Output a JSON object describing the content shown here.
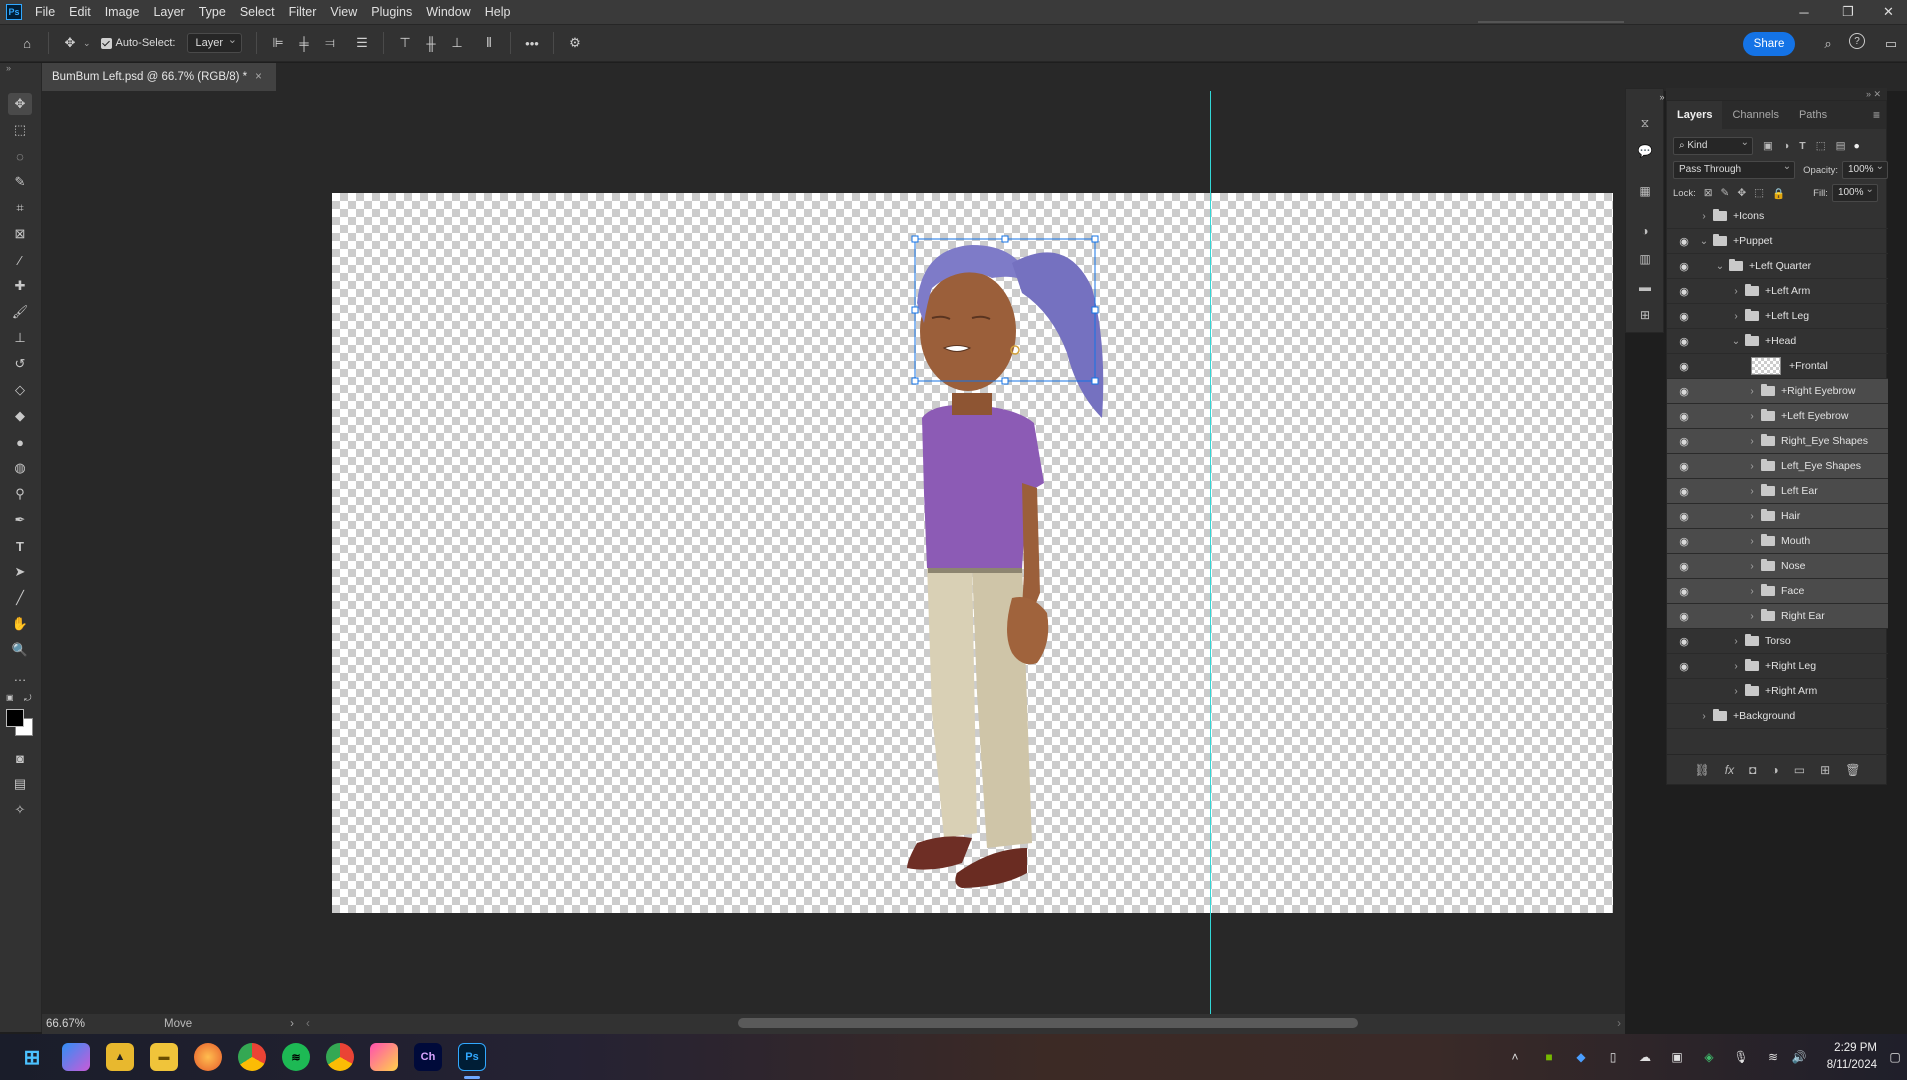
{
  "menubar": {
    "app_logo": "Ps",
    "items": [
      "File",
      "Edit",
      "Image",
      "Layer",
      "Type",
      "Select",
      "Filter",
      "View",
      "Plugins",
      "Window",
      "Help"
    ]
  },
  "options_bar": {
    "auto_select_label": "Auto-Select:",
    "auto_select_target": "Layer",
    "share_label": "Share"
  },
  "document": {
    "tab_title": "BumBum Left.psd @ 66.7% (RGB/8) *",
    "close_glyph": "×"
  },
  "status": {
    "zoom": "66.67%",
    "tool_info": "Move"
  },
  "layers_panel": {
    "tabs": [
      "Layers",
      "Channels",
      "Paths"
    ],
    "filter_kind": "Kind",
    "blend_mode": "Pass Through",
    "opacity_label": "Opacity:",
    "opacity_value": "100%",
    "lock_label": "Lock:",
    "fill_label": "Fill:",
    "fill_value": "100%",
    "layers": [
      {
        "name": "+Icons",
        "visible": false,
        "depth": 0,
        "expanded": false,
        "type": "group",
        "selected": false
      },
      {
        "name": "+Puppet",
        "visible": true,
        "depth": 0,
        "expanded": true,
        "type": "group",
        "selected": false
      },
      {
        "name": "+Left Quarter",
        "visible": true,
        "depth": 1,
        "expanded": true,
        "type": "group",
        "selected": false
      },
      {
        "name": "+Left Arm",
        "visible": true,
        "depth": 2,
        "expanded": false,
        "type": "group",
        "selected": false
      },
      {
        "name": "+Left Leg",
        "visible": true,
        "depth": 2,
        "expanded": false,
        "type": "group",
        "selected": false
      },
      {
        "name": "+Head",
        "visible": true,
        "depth": 2,
        "expanded": true,
        "type": "group",
        "selected": false
      },
      {
        "name": "+Frontal",
        "visible": true,
        "depth": 3,
        "expanded": false,
        "type": "pixel",
        "selected": false
      },
      {
        "name": "+Right Eyebrow",
        "visible": true,
        "depth": 3,
        "expanded": false,
        "type": "group",
        "selected": true
      },
      {
        "name": "+Left Eyebrow",
        "visible": true,
        "depth": 3,
        "expanded": false,
        "type": "group",
        "selected": true
      },
      {
        "name": "Right_Eye Shapes",
        "visible": true,
        "depth": 3,
        "expanded": false,
        "type": "group",
        "selected": true
      },
      {
        "name": "Left_Eye Shapes",
        "visible": true,
        "depth": 3,
        "expanded": false,
        "type": "group",
        "selected": true
      },
      {
        "name": "Left Ear",
        "visible": true,
        "depth": 3,
        "expanded": false,
        "type": "group",
        "selected": true
      },
      {
        "name": "Hair",
        "visible": true,
        "depth": 3,
        "expanded": false,
        "type": "group",
        "selected": true
      },
      {
        "name": "Mouth",
        "visible": true,
        "depth": 3,
        "expanded": false,
        "type": "group",
        "selected": true
      },
      {
        "name": "Nose",
        "visible": true,
        "depth": 3,
        "expanded": false,
        "type": "group",
        "selected": true
      },
      {
        "name": "Face",
        "visible": true,
        "depth": 3,
        "expanded": false,
        "type": "group",
        "selected": true
      },
      {
        "name": "Right Ear",
        "visible": true,
        "depth": 3,
        "expanded": false,
        "type": "group",
        "selected": true
      },
      {
        "name": "Torso",
        "visible": true,
        "depth": 2,
        "expanded": false,
        "type": "group",
        "selected": false
      },
      {
        "name": "+Right Leg",
        "visible": true,
        "depth": 2,
        "expanded": false,
        "type": "group",
        "selected": false
      },
      {
        "name": "+Right Arm",
        "visible": false,
        "depth": 2,
        "expanded": false,
        "type": "group",
        "selected": false
      },
      {
        "name": "+Background",
        "visible": false,
        "depth": 0,
        "expanded": false,
        "type": "group",
        "selected": false
      }
    ]
  },
  "taskbar": {
    "apps": [
      "Start",
      "Copilot",
      "File Explorer Game",
      "File Explorer",
      "Firefox",
      "Chrome",
      "Spotify",
      "Chrome Profile",
      "Photo App",
      "Ch",
      "Ps"
    ],
    "time": "2:29 PM",
    "date": "8/11/2024"
  },
  "colors": {
    "accent": "#1473e6",
    "guide": "#33d7d7",
    "panel_bg": "#323232",
    "hair": "#7e7bc8",
    "shirt": "#8c5bb5",
    "skin": "#9b5f3a",
    "pants": "#d9d0b5",
    "shoes": "#6e2e25"
  }
}
